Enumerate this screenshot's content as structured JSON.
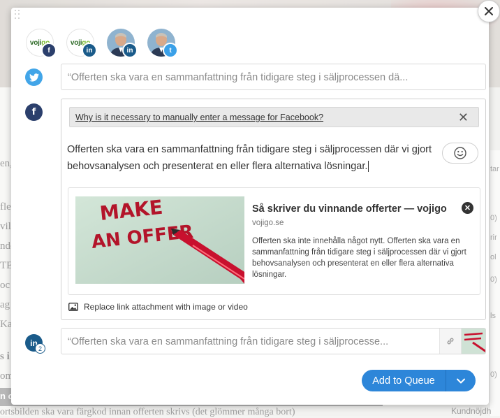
{
  "background": {
    "left_fragments": [
      "en,",
      "fle",
      "vil",
      "nde",
      "TE",
      "oc",
      "ag",
      "Ka",
      "s i",
      "om"
    ],
    "right_fragments": [
      "tar",
      "0)",
      "rir",
      "ol",
      "0)",
      "ls",
      "0)"
    ],
    "bottom_bar_text": "n o",
    "bottom_text": "ortsbilden ska vara färgkod innan offerten skrivs (det glömmer många bort)",
    "bottom_right_text": "Kundnöjdh"
  },
  "profiles": [
    {
      "name": "vojigo",
      "network": "facebook",
      "badge": "f"
    },
    {
      "name": "vojigo",
      "network": "linkedin",
      "badge": "in"
    },
    {
      "network": "linkedin",
      "badge": "in"
    },
    {
      "network": "twitter",
      "badge": "t"
    }
  ],
  "logo": {
    "prefix": "voji",
    "suffix": "go"
  },
  "twitter": {
    "placeholder_text": "“Offerten ska vara en sammanfattning från tidigare steg i säljprocessen dä..."
  },
  "facebook": {
    "notice_link": "Why is it necessary to manually enter a message for Facebook?",
    "message": "Offerten ska vara en sammanfattning från tidigare steg i säljprocessen där vi gjort behovsanalysen och presenterat en eller flera alternativa lösningar.",
    "link_card": {
      "title": "Så skriver du vinnande offerter — vojigo",
      "domain": "vojigo.se",
      "description": "Offerten ska inte innehålla något nytt. Offerten ska vara en sammanfattning från tidigare steg i säljprocessen där vi gjort behovsanalysen och presenterat en eller flera alternativa lösningar.",
      "thumb_line1": "MAKE",
      "thumb_line2": "AN OFFER"
    },
    "replace_label": "Replace link attachment with image or video"
  },
  "linkedin": {
    "count": "2",
    "placeholder_text": "“Offerten ska vara en sammanfattning från tidigare steg i säljprocesse..."
  },
  "actions": {
    "add_to_queue": "Add to Queue"
  },
  "colors": {
    "primary": "#2d86d9",
    "facebook": "#2b3f6c",
    "linkedin": "#1a5b8a",
    "twitter": "#42a5e8"
  }
}
